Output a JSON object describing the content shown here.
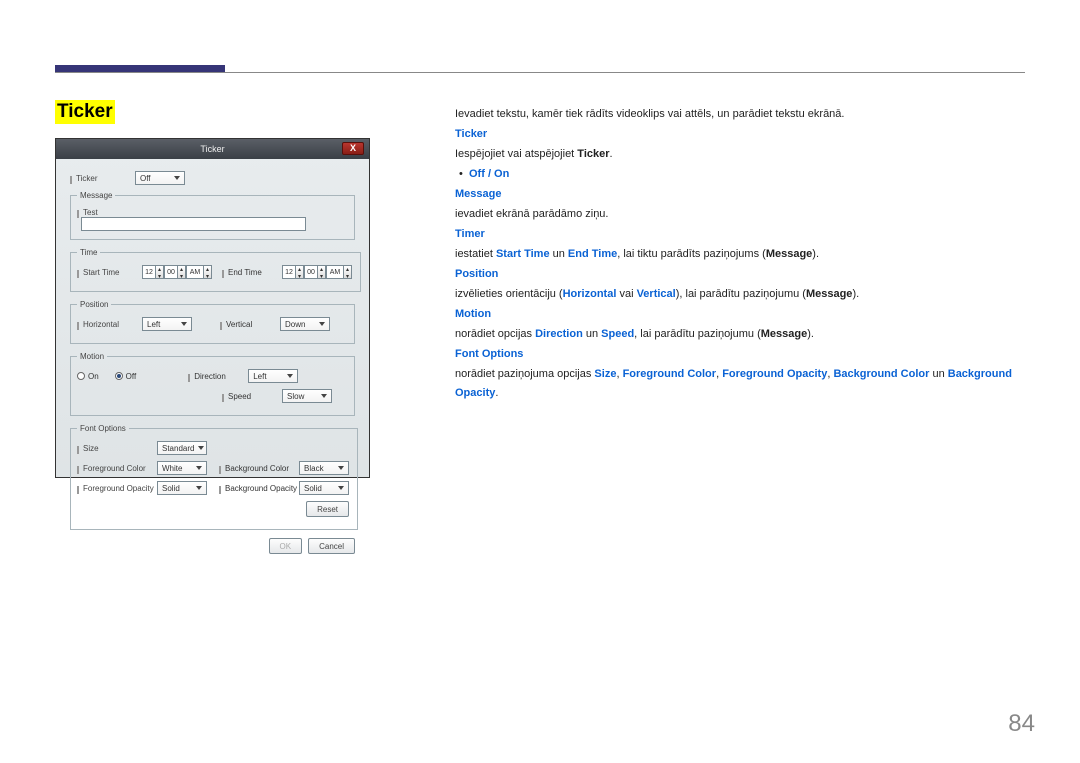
{
  "page_number": "84",
  "heading": "Ticker",
  "dialog": {
    "title": "Ticker",
    "close": "X",
    "ticker_label": "Ticker",
    "ticker_value": "Off",
    "message_label": "Message",
    "message_value": "Test",
    "time_label": "Time",
    "start_time_label": "Start Time",
    "start_h": "12",
    "start_m": "00",
    "start_ampm": "AM",
    "end_time_label": "End Time",
    "end_h": "12",
    "end_m": "00",
    "end_ampm": "AM",
    "position_label": "Position",
    "horizontal_label": "Horizontal",
    "horizontal_value": "Left",
    "vertical_label": "Vertical",
    "vertical_value": "Down",
    "motion_label": "Motion",
    "on_label": "On",
    "off_label": "Off",
    "direction_label": "Direction",
    "direction_value": "Left",
    "speed_label": "Speed",
    "speed_value": "Slow",
    "font_options_label": "Font Options",
    "size_label": "Size",
    "size_value": "Standard",
    "fg_color_label": "Foreground Color",
    "fg_color_value": "White",
    "fg_opacity_label": "Foreground Opacity",
    "fg_opacity_value": "Solid",
    "bg_color_label": "Background Color",
    "bg_color_value": "Black",
    "bg_opacity_label": "Background Opacity",
    "bg_opacity_value": "Solid",
    "reset": "Reset",
    "ok": "OK",
    "cancel": "Cancel"
  },
  "doc": {
    "intro": "Ievadiet tekstu, kamēr tiek rādīts videoklips vai attēls, un parādiet tekstu ekrānā.",
    "h_ticker": "Ticker",
    "ticker_desc_a": "Iespējojiet vai atspējojiet ",
    "ticker_desc_b": "Ticker",
    "off_on": "Off / On",
    "h_message": "Message",
    "message_desc": "ievadiet ekrānā parādāmo ziņu.",
    "h_timer": "Timer",
    "timer_desc_a": "iestatiet ",
    "timer_start": "Start Time",
    "timer_un": " un ",
    "timer_end": "End Time",
    "timer_desc_b": ", lai tiktu parādīts paziņojums (",
    "timer_msg": "Message",
    "timer_desc_c": ").",
    "h_position": "Position",
    "pos_a": "izvēlieties orientāciju (",
    "pos_h": "Horizontal",
    "pos_or": " vai ",
    "pos_v": "Vertical",
    "pos_b": "), lai parādītu paziņojumu (",
    "pos_msg": "Message",
    "pos_c": ").",
    "h_motion": "Motion",
    "mot_a": "norādiet opcijas ",
    "mot_dir": "Direction",
    "mot_un": " un ",
    "mot_spd": "Speed",
    "mot_b": ", lai parādītu paziņojumu (",
    "mot_msg": "Message",
    "mot_c": ").",
    "h_font": "Font Options",
    "font_a": "norādiet paziņojuma opcijas ",
    "font_size": "Size",
    "font_s1": ", ",
    "font_fgc": "Foreground Color",
    "font_s2": ", ",
    "font_fgo": "Foreground Opacity",
    "font_s3": ", ",
    "font_bgc": "Background Color",
    "font_s4": " un ",
    "font_bgo": "Background Opacity",
    "font_s5": "."
  }
}
